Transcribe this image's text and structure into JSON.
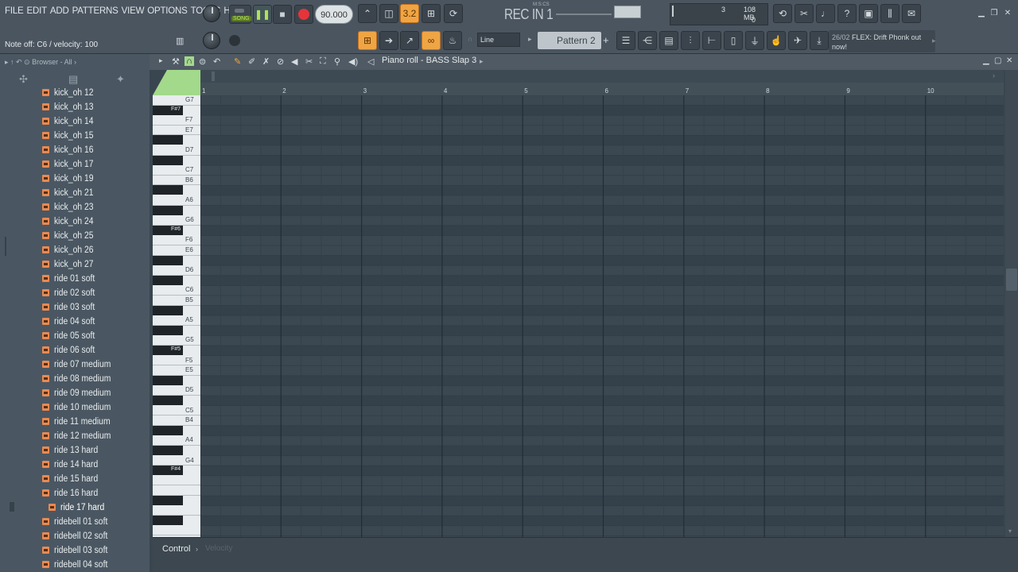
{
  "menu": [
    "FILE",
    "EDIT",
    "ADD",
    "PATTERNS",
    "VIEW",
    "OPTIONS",
    "TOOLS",
    "HELP"
  ],
  "hint": "Note off: C6 / velocity: 100",
  "transport": {
    "song_label": "SONG",
    "tempo": "90.000",
    "rec_in": "REC IN 1",
    "rec_in_small": "M:S:CS"
  },
  "cpu": {
    "value1": "3",
    "mem": "108 MB",
    "value2": "0"
  },
  "snap": {
    "value": "3.2"
  },
  "pattern": {
    "mode": "Line",
    "name": "Pattern 2"
  },
  "news": {
    "date": "26/02",
    "text": "FLEX: Drift Phonk out now!"
  },
  "browser": {
    "header": "Browser - All",
    "items": [
      "kick_oh 12",
      "kick_oh 13",
      "kick_oh 14",
      "kick_oh 15",
      "kick_oh 16",
      "kick_oh 17",
      "kick_oh 19",
      "kick_oh 21",
      "kick_oh 23",
      "kick_oh 24",
      "kick_oh 25",
      "kick_oh 26",
      "kick_oh 27",
      "ride 01 soft",
      "ride 02 soft",
      "ride 03 soft",
      "ride 04 soft",
      "ride 05 soft",
      "ride 06 soft",
      "ride 07 medium",
      "ride 08 medium",
      "ride 09 medium",
      "ride 10 medium",
      "ride 11 medium",
      "ride 12 medium",
      "ride 13 hard",
      "ride 14 hard",
      "ride 15 hard",
      "ride 16 hard",
      "ride 17 hard",
      "ridebell 01 soft",
      "ridebell 02 soft",
      "ridebell 03 soft",
      "ridebell 04 soft"
    ],
    "selected_index": 29
  },
  "piano_roll": {
    "title": "Piano roll - BASS Slap 3",
    "bars": [
      "1",
      "2",
      "3",
      "4",
      "5",
      "6",
      "7",
      "8",
      "9",
      "10"
    ],
    "key_labels": [
      {
        "name": "G7"
      },
      {
        "name": "F#7",
        "black": true
      },
      {
        "name": "F7"
      },
      {
        "name": "E7"
      },
      {
        "name": "D7"
      },
      {
        "name": "C7"
      },
      {
        "name": "B6"
      },
      {
        "name": "A6"
      },
      {
        "name": "G6"
      },
      {
        "name": "F#6",
        "black": true
      },
      {
        "name": "F6"
      },
      {
        "name": "E6"
      },
      {
        "name": "D6"
      },
      {
        "name": "C6"
      },
      {
        "name": "B5"
      },
      {
        "name": "A5"
      },
      {
        "name": "G5"
      },
      {
        "name": "F#5",
        "black": true
      },
      {
        "name": "F5"
      },
      {
        "name": "E5"
      },
      {
        "name": "D5"
      },
      {
        "name": "C5"
      },
      {
        "name": "B4"
      },
      {
        "name": "A4"
      },
      {
        "name": "G4"
      },
      {
        "name": "F#4",
        "black": true
      }
    ],
    "control_label": "Control",
    "control_target": "Velocity"
  },
  "colors": {
    "grid_dark": "#34404a",
    "grid_light": "#3b4751",
    "accent_green": "#a3d98a",
    "accent_orange": "#f0a544",
    "record_red": "#e4353b"
  }
}
